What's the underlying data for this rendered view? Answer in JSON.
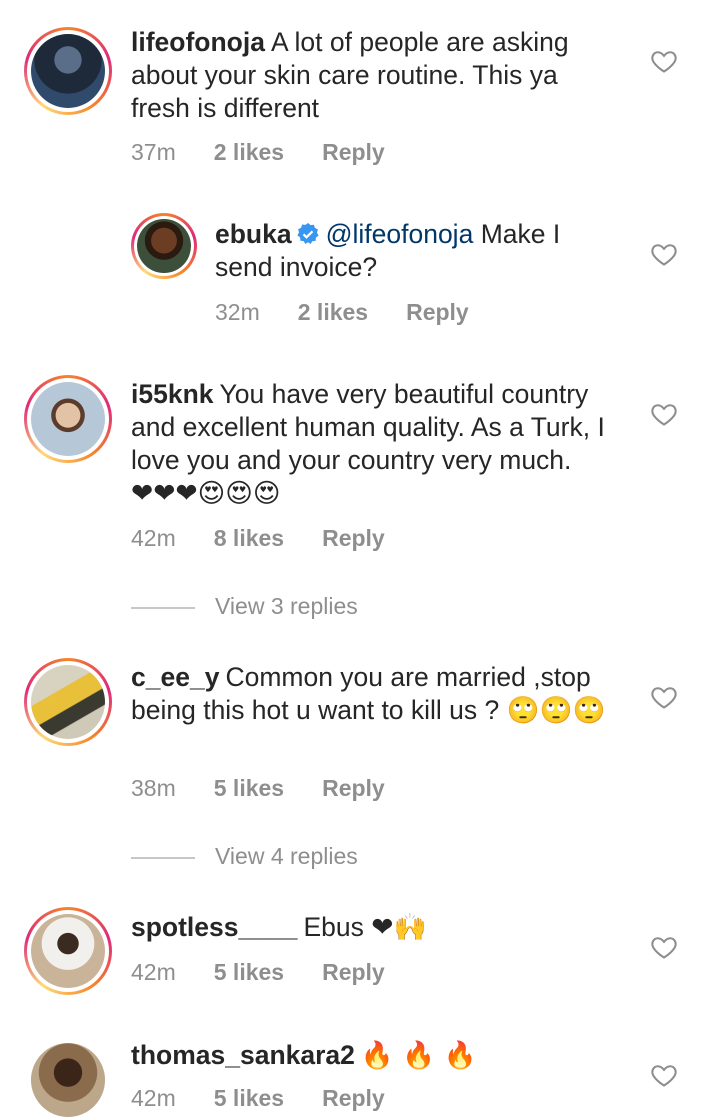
{
  "comments": [
    {
      "username": "lifeofonoja",
      "text": "A lot of people are asking about your skin care routine. This ya fresh is different",
      "time": "37m",
      "likes": "2 likes",
      "reply": "Reply"
    },
    {
      "username": "ebuka",
      "mention": "@lifeofonoja",
      "text": "Make I send invoice?",
      "time": "32m",
      "likes": "2 likes",
      "reply": "Reply"
    },
    {
      "username": "i55knk",
      "text": "You have very beautiful country and excellent human quality. As a Turk, I love you and your country very much.",
      "emoji": "❤❤❤😍😍😍",
      "time": "42m",
      "likes": "8 likes",
      "reply": "Reply",
      "view_replies": "View 3 replies"
    },
    {
      "username": "c_ee_y",
      "text": "Common you are married ,stop being this hot u want to kill us ?",
      "emoji": "🙄🙄🙄",
      "time": "38m",
      "likes": "5 likes",
      "reply": "Reply",
      "view_replies": "View 4 replies"
    },
    {
      "username": "spotless____",
      "text": "Ebus",
      "emoji": "❤🙌",
      "time": "42m",
      "likes": "5 likes",
      "reply": "Reply"
    },
    {
      "username": "thomas_sankara2",
      "emoji": "🔥 🔥 🔥",
      "time": "42m",
      "likes": "5 likes",
      "reply": "Reply"
    }
  ],
  "colors": {
    "text": "#262626",
    "muted": "#8e8e8e",
    "mention": "#00376b",
    "verified": "#3897f0"
  }
}
